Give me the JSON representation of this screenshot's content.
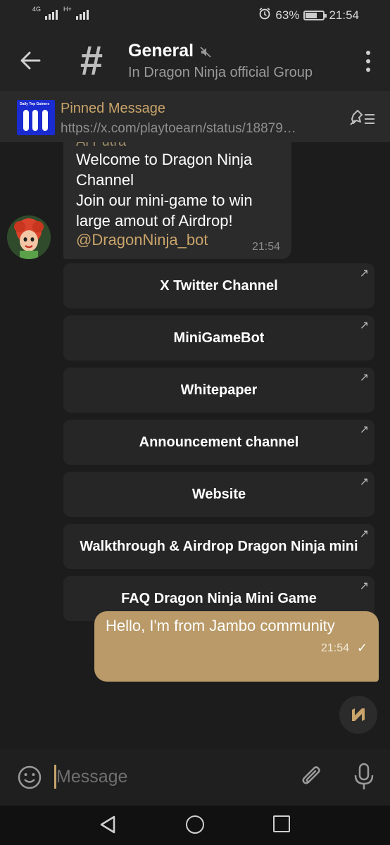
{
  "status_bar": {
    "network1": "4G",
    "network2": "H+",
    "battery_text": "63%",
    "battery_level": 0.63,
    "time": "21:54"
  },
  "header": {
    "title": "General",
    "subtitle": "In Dragon Ninja official Group"
  },
  "pinned": {
    "label": "Pinned Message",
    "url": "https://x.com/playtoearn/status/18879…",
    "thumb_text": "Daily Top Gainers"
  },
  "incoming_message": {
    "sender": "Al Putra",
    "text": "Welcome to Dragon Ninja Channel\nJoin our mini-game to win large amout of Airdrop!",
    "mention": "@DragonNinja_bot",
    "time": "21:54"
  },
  "keyboard_buttons": [
    {
      "label": "X Twitter Channel"
    },
    {
      "label": "MiniGameBot"
    },
    {
      "label": "Whitepaper"
    },
    {
      "label": "Announcement channel"
    },
    {
      "label": "Website"
    },
    {
      "label": "Walkthrough & Airdrop Dragon Ninja mini"
    },
    {
      "label": "FAQ Dragon Ninja Mini Game"
    }
  ],
  "outgoing_message": {
    "text": "Hello, I'm from Jambo community",
    "time": "21:54"
  },
  "input": {
    "placeholder": "Message"
  },
  "colors": {
    "accent": "#c9a46a",
    "outgoing_bubble": "#b99a68",
    "background": "#1c1c1c"
  }
}
